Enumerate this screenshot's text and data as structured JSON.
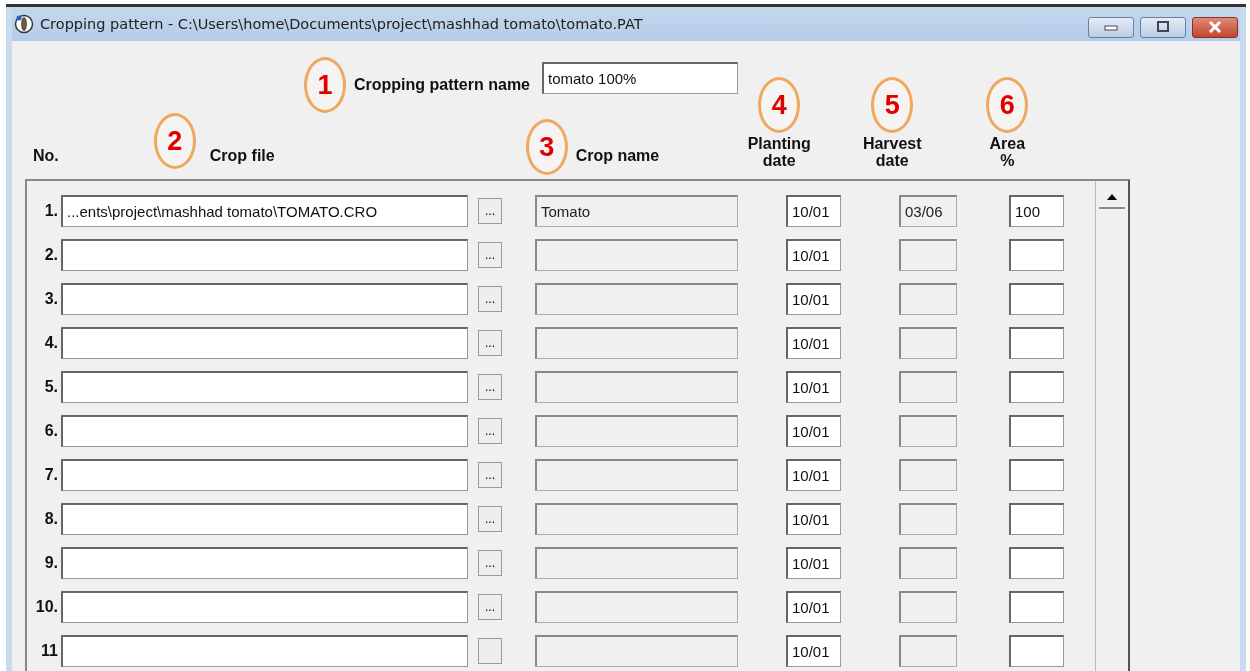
{
  "window": {
    "title": "Cropping pattern - C:\\Users\\home\\Documents\\project\\mashhad tomato\\tomato.PAT"
  },
  "pattern_name": {
    "label": "Cropping pattern name",
    "value": "tomato 100%"
  },
  "callouts": [
    "1",
    "2",
    "3",
    "4",
    "5",
    "6"
  ],
  "columns": {
    "no": "No.",
    "crop_file": "Crop file",
    "crop_name": "Crop name",
    "planting_date": "Planting date",
    "harvest_date": "Harvest date",
    "area": "Area %"
  },
  "field_states": {
    "crop_name_disabled": true,
    "harvest_date_disabled": true
  },
  "rows": [
    {
      "no": "1.",
      "crop_file": "...ents\\project\\mashhad tomato\\TOMATO.CRO",
      "browse": "...",
      "crop_name": "Tomato",
      "planting_date": "10/01",
      "harvest_date": "03/06",
      "area": "100"
    },
    {
      "no": "2.",
      "browse": "...",
      "planting_date": "10/01"
    },
    {
      "no": "3.",
      "browse": "...",
      "planting_date": "10/01"
    },
    {
      "no": "4.",
      "browse": "...",
      "planting_date": "10/01"
    },
    {
      "no": "5.",
      "browse": "...",
      "planting_date": "10/01"
    },
    {
      "no": "6.",
      "browse": "...",
      "planting_date": "10/01"
    },
    {
      "no": "7.",
      "browse": "...",
      "planting_date": "10/01"
    },
    {
      "no": "8.",
      "browse": "...",
      "planting_date": "10/01"
    },
    {
      "no": "9.",
      "browse": "...",
      "planting_date": "10/01"
    },
    {
      "no": "10.",
      "browse": "...",
      "planting_date": "10/01"
    },
    {
      "no": "11",
      "planting_date": "10/01"
    }
  ]
}
